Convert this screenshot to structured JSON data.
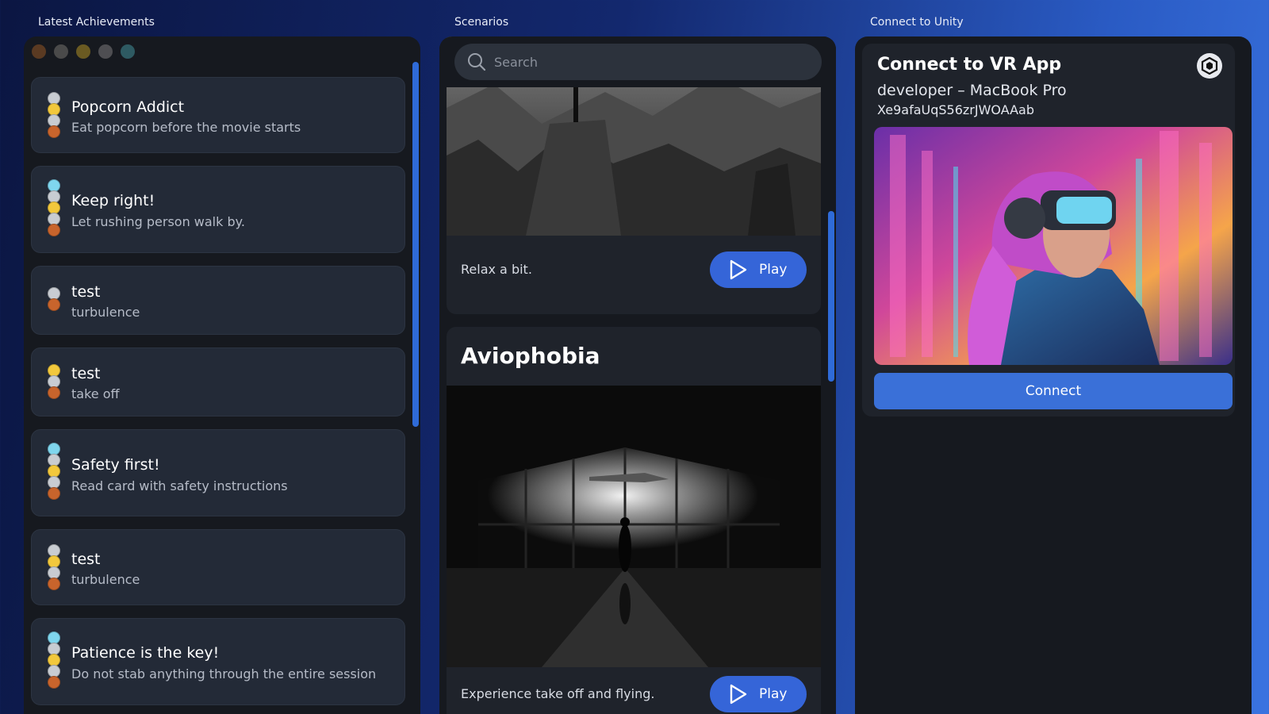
{
  "labels": {
    "achievements": "Latest Achievements",
    "scenarios": "Scenarios",
    "unity": "Connect to Unity"
  },
  "window_dots": [
    "#5a3a22",
    "#4a4a4a",
    "#6a5a22",
    "#4e4e52",
    "#2e5a62"
  ],
  "achievements": [
    {
      "title": "Popcorn Addict",
      "desc": "Eat popcorn before the movie starts",
      "medals": [
        "#c8ccd2",
        "#f2c83c",
        "#c8ccd2",
        "#c8642c"
      ]
    },
    {
      "title": "Keep right!",
      "desc": "Let rushing person walk by.",
      "medals": [
        "#7fd6ee",
        "#c8ccd2",
        "#f2c83c",
        "#c8ccd2",
        "#c8642c"
      ]
    },
    {
      "title": "test",
      "desc": "turbulence",
      "medals": [
        "#c8ccd2",
        "#c8642c"
      ]
    },
    {
      "title": "test",
      "desc": "take off",
      "medals": [
        "#f2c83c",
        "#c8ccd2",
        "#c8642c"
      ]
    },
    {
      "title": "Safety first!",
      "desc": "Read card with safety instructions",
      "medals": [
        "#7fd6ee",
        "#c8ccd2",
        "#f2c83c",
        "#c8ccd2",
        "#c8642c"
      ]
    },
    {
      "title": "test",
      "desc": "turbulence",
      "medals": [
        "#c8ccd2",
        "#f2c83c",
        "#c8ccd2",
        "#c8642c"
      ]
    },
    {
      "title": "Patience is the key!",
      "desc": "Do not stab anything through the entire session",
      "medals": [
        "#7fd6ee",
        "#c8ccd2",
        "#f2c83c",
        "#c8ccd2",
        "#c8642c"
      ]
    }
  ],
  "search": {
    "placeholder": "Search"
  },
  "scenarios": [
    {
      "title": "",
      "desc": "Relax a bit.",
      "play": "Play"
    },
    {
      "title": "Aviophobia",
      "desc": "Experience take off and flying.",
      "play": "Play"
    }
  ],
  "unity": {
    "title": "Connect to VR App",
    "device": "developer – MacBook Pro",
    "code": "Xe9afaUqS56zrJWOAAab",
    "connect": "Connect"
  },
  "colors": {
    "accent": "#3565d8",
    "panel": "#16191f",
    "card": "#232a37"
  }
}
